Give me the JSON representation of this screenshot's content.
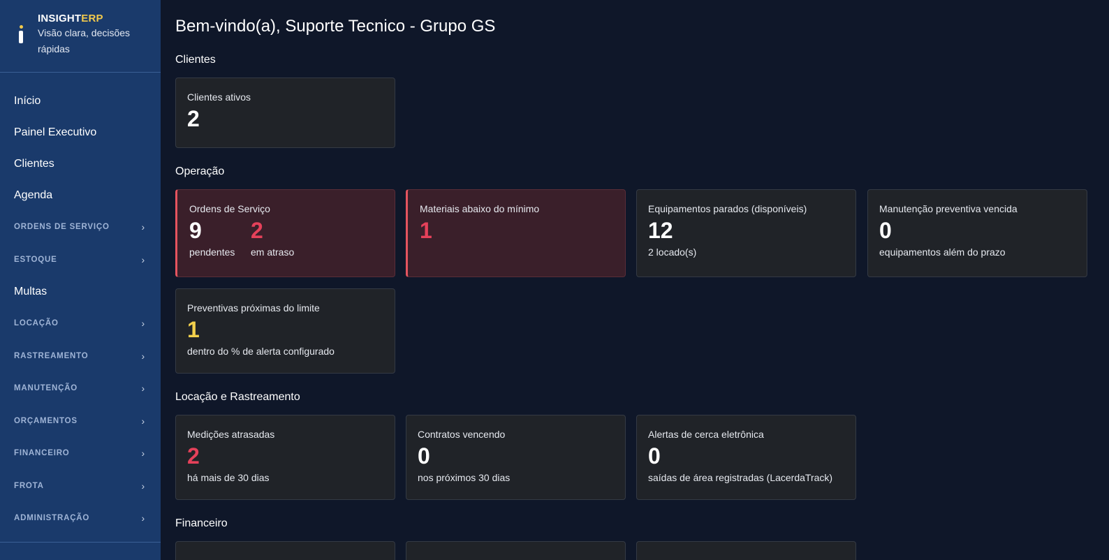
{
  "brand": {
    "name_main": "INSIGHT",
    "name_accent": "ERP",
    "tagline": "Visão clara, decisões rápidas"
  },
  "sidebar": {
    "items": [
      {
        "label": "Início"
      },
      {
        "label": "Painel Executivo"
      },
      {
        "label": "Clientes"
      },
      {
        "label": "Agenda"
      },
      {
        "label": "ORDENS DE SERVIÇO",
        "group": true
      },
      {
        "label": "ESTOQUE",
        "group": true
      },
      {
        "label": "Multas"
      },
      {
        "label": "LOCAÇÃO",
        "group": true
      },
      {
        "label": "RASTREAMENTO",
        "group": true
      },
      {
        "label": "MANUTENÇÃO",
        "group": true
      },
      {
        "label": "ORÇAMENTOS",
        "group": true
      },
      {
        "label": "FINANCEIRO",
        "group": true
      },
      {
        "label": "FROTA",
        "group": true
      },
      {
        "label": "ADMINISTRAÇÃO",
        "group": true
      }
    ],
    "chevron": "›"
  },
  "header": {
    "title": "Bem-vindo(a), Suporte Tecnico - Grupo GS"
  },
  "sections": {
    "clientes": {
      "title": "Clientes",
      "cards": [
        {
          "label": "Clientes ativos",
          "value": "2"
        }
      ]
    },
    "operacao": {
      "title": "Operação",
      "cards": [
        {
          "label": "Ordens de Serviço",
          "value_a": "9",
          "sub_a": "pendentes",
          "value_b": "2",
          "sub_b": "em atraso"
        },
        {
          "label": "Materiais abaixo do mínimo",
          "value": "1"
        },
        {
          "label": "Equipamentos parados (disponíveis)",
          "value": "12",
          "sub": "2 locado(s)"
        },
        {
          "label": "Manutenção preventiva vencida",
          "value": "0",
          "sub": "equipamentos além do prazo"
        },
        {
          "label": "Preventivas próximas do limite",
          "value": "1",
          "sub": "dentro do % de alerta configurado"
        }
      ]
    },
    "locacao": {
      "title": "Locação e Rastreamento",
      "cards": [
        {
          "label": "Medições atrasadas",
          "value": "2",
          "sub": "há mais de 30 dias"
        },
        {
          "label": "Contratos vencendo",
          "value": "0",
          "sub": "nos próximos 30 dias"
        },
        {
          "label": "Alertas de cerca eletrônica",
          "value": "0",
          "sub": "saídas de área registradas (LacerdaTrack)"
        }
      ]
    },
    "financeiro": {
      "title": "Financeiro"
    }
  },
  "colors": {
    "sidebar_bg": "#1a3a6b",
    "page_bg": "#0f1729",
    "card_bg": "#202328",
    "alert_bg": "#3a1f2a",
    "alert_border": "#e5545f",
    "danger": "#e5415a",
    "warning": "#f2d04c",
    "brand_accent": "#f2c94c"
  }
}
